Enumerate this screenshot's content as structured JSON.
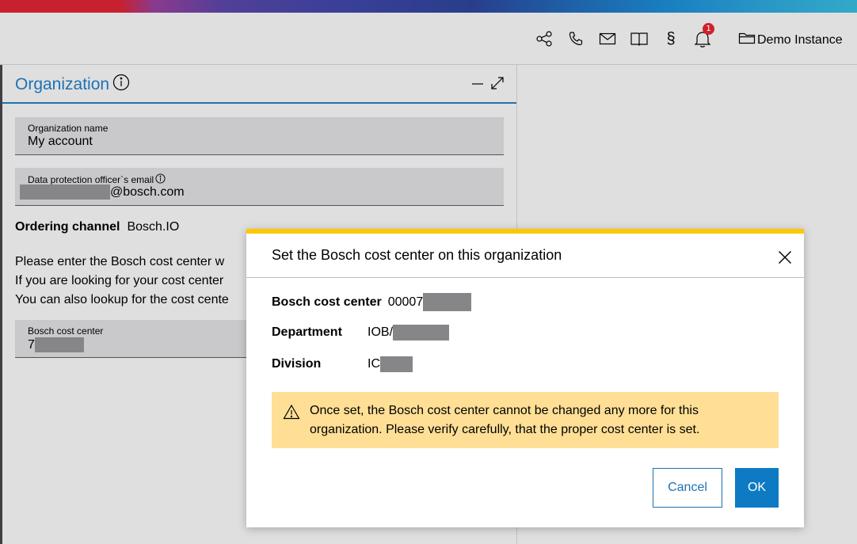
{
  "header": {
    "icons": [
      "share-icon",
      "phone-icon",
      "mail-icon",
      "book-icon",
      "paragraph-icon",
      "bell-icon",
      "folder-icon"
    ],
    "notification_count": "1",
    "instance_label": "Demo Instance"
  },
  "panel": {
    "title": "Organization",
    "org_name_label": "Organization name",
    "org_name_value": "My account",
    "dpo_email_label": "Data protection officer`s email",
    "dpo_email_domain": "@bosch.com",
    "ordering_label": "Ordering channel",
    "ordering_value": "Bosch.IO",
    "info_lines": [
      "Please enter the Bosch cost center w",
      "If you are looking for your cost center",
      "You can also lookup for the cost cente"
    ],
    "cost_center_label": "Bosch cost center",
    "cost_center_value_prefix": "7"
  },
  "dialog": {
    "title": "Set the Bosch cost center on this organization",
    "cost_center_label": "Bosch cost center",
    "cost_center_prefix": "00007",
    "department_label": "Department",
    "department_prefix": "IOB/",
    "division_label": "Division",
    "division_prefix": "IC",
    "warning_text": "Once set, the Bosch cost center cannot be changed any more for this organization. Please verify carefully, that the proper cost center is set.",
    "cancel_label": "Cancel",
    "ok_label": "OK"
  },
  "colors": {
    "accent": "#1f72b2",
    "primary_button": "#0e7ac4",
    "warning_bg": "#ffdf95",
    "dialog_top_border": "#fcc800",
    "badge": "#d0212b"
  }
}
